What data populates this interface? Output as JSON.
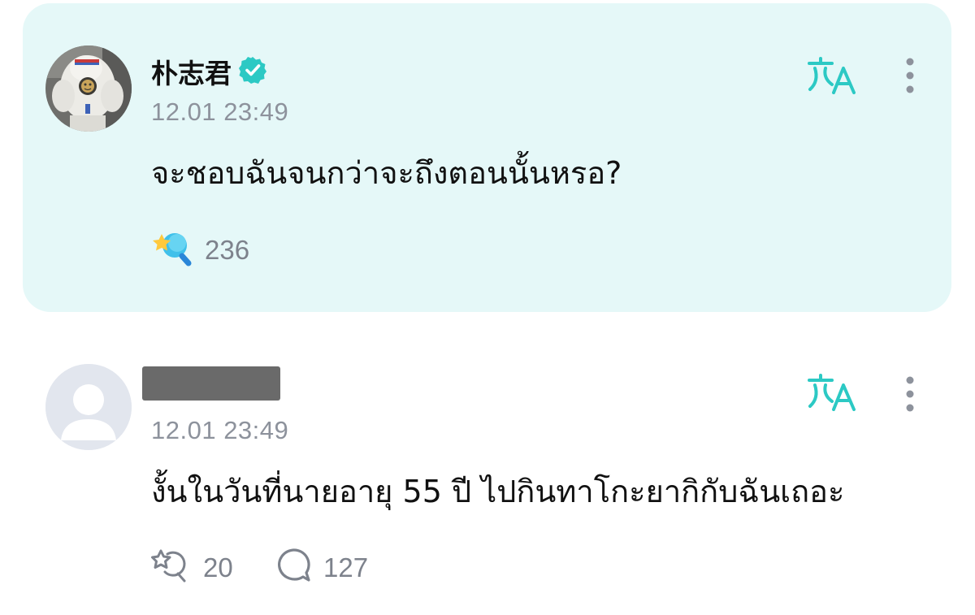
{
  "post": {
    "author": {
      "name": "朴志君",
      "verified": true,
      "avatar": "artist-photo"
    },
    "timestamp": "12.01 23:49",
    "text": "จะชอบฉันจนกว่าจะถึงตอนนั้นหรอ?",
    "reaction_count": "236",
    "icons": {
      "translate": "translate-icon",
      "more": "more-vertical-icon",
      "reaction": "reaction-star-icon",
      "verified": "verified-badge-icon"
    }
  },
  "comment": {
    "author": {
      "name_redacted": true,
      "avatar": "default-avatar"
    },
    "timestamp": "12.01 23:49",
    "text": "งั้นในวันที่นายอายุ 55 ปี ไปกินทาโกะยากิกับฉันเถอะ",
    "reaction_count": "20",
    "reply_count": "127",
    "icons": {
      "translate": "translate-icon",
      "more": "more-vertical-icon",
      "reaction": "reaction-outline-icon",
      "reply": "comment-bubble-icon"
    }
  },
  "colors": {
    "accent": "#2cc9c4",
    "card_background": "#e5f8f8",
    "timestamp": "#8d929c",
    "text": "#111111"
  }
}
